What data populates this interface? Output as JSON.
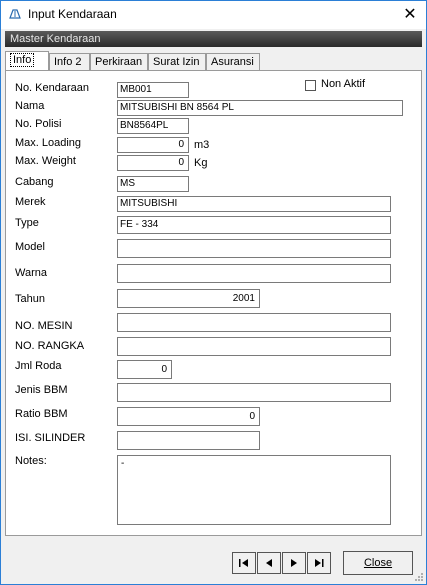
{
  "window": {
    "title": "Input Kendaraan",
    "close_glyph": "✕",
    "app_icon": "vehicle-icon"
  },
  "group_title": "Master Kendaraan",
  "tabs": [
    "Info",
    "Info 2",
    "Perkiraan",
    "Surat Izin",
    "Asuransi"
  ],
  "active_tab": "Info",
  "fields": {
    "no_kendaraan": {
      "label": "No. Kendaraan",
      "value": "MB001"
    },
    "non_aktif": {
      "label": "Non Aktif",
      "checked": false
    },
    "nama": {
      "label": "Nama",
      "value": "MITSUBISHI BN 8564 PL"
    },
    "no_polisi": {
      "label": "No. Polisi",
      "value": "BN8564PL"
    },
    "max_loading": {
      "label": "Max. Loading",
      "value": "0",
      "unit": "m3"
    },
    "max_weight": {
      "label": "Max. Weight",
      "value": "0",
      "unit": "Kg"
    },
    "cabang": {
      "label": "Cabang",
      "value": "MS"
    },
    "merek": {
      "label": "Merek",
      "value": "MITSUBISHI"
    },
    "type": {
      "label": "Type",
      "value": "FE - 334"
    },
    "model": {
      "label": "Model",
      "value": ""
    },
    "warna": {
      "label": "Warna",
      "value": ""
    },
    "tahun": {
      "label": "Tahun",
      "value": "2001"
    },
    "no_mesin": {
      "label": "NO. MESIN",
      "value": ""
    },
    "no_rangka": {
      "label": "NO. RANGKA",
      "value": ""
    },
    "jml_roda": {
      "label": "Jml Roda",
      "value": "0"
    },
    "jenis_bbm": {
      "label": "Jenis BBM",
      "value": ""
    },
    "ratio_bbm": {
      "label": "Ratio BBM",
      "value": "0"
    },
    "isi_silinder": {
      "label": "ISI. SILINDER",
      "value": ""
    },
    "notes": {
      "label": "Notes:",
      "value": "-"
    }
  },
  "footer": {
    "nav": [
      "first-record-icon",
      "prev-record-icon",
      "next-record-icon",
      "last-record-icon"
    ],
    "close_label": "Close"
  }
}
